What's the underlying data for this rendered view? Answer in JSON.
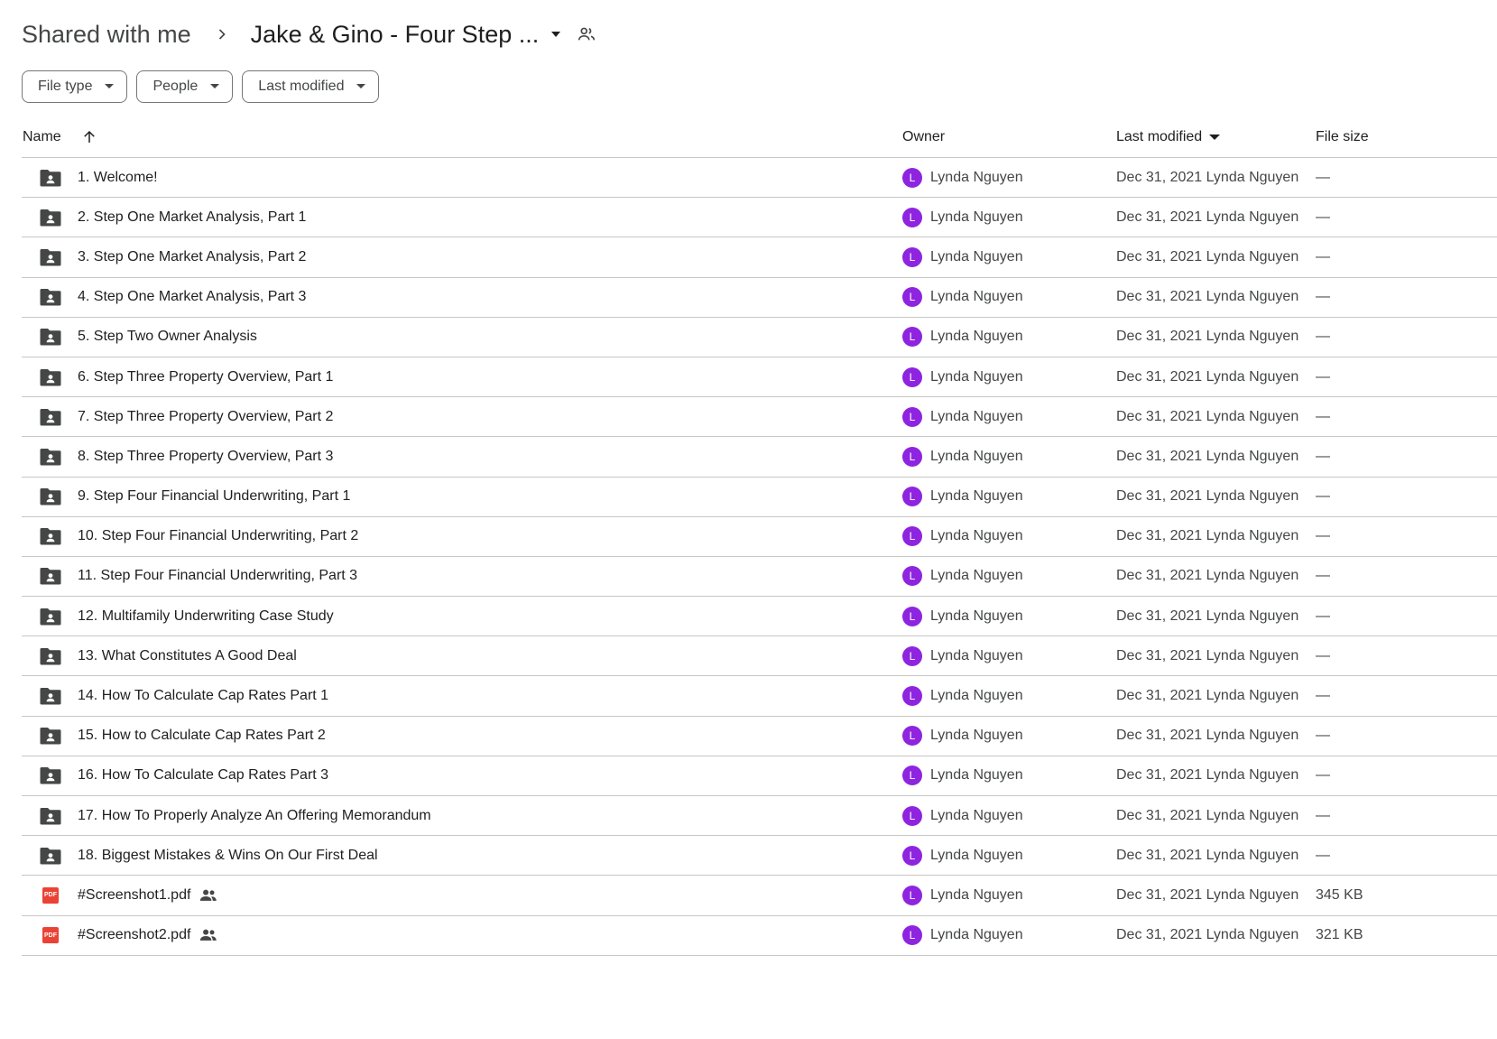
{
  "breadcrumb": {
    "root": "Shared with me",
    "current": "Jake & Gino - Four Step ..."
  },
  "filters": [
    {
      "label": "File type"
    },
    {
      "label": "People"
    },
    {
      "label": "Last modified"
    }
  ],
  "columns": {
    "name": "Name",
    "owner": "Owner",
    "last_modified": "Last modified",
    "file_size": "File size"
  },
  "colors": {
    "avatar": "#8e24e0",
    "folder_icon": "#444746",
    "pdf_icon": "#ea4335"
  },
  "rows": [
    {
      "type": "shared-folder",
      "name": "1. Welcome!",
      "owner_initial": "L",
      "owner": "Lynda Nguyen",
      "modified": "Dec 31, 2021 Lynda Nguyen",
      "size": "—"
    },
    {
      "type": "shared-folder",
      "name": "2. Step One Market Analysis, Part 1",
      "owner_initial": "L",
      "owner": "Lynda Nguyen",
      "modified": "Dec 31, 2021 Lynda Nguyen",
      "size": "—"
    },
    {
      "type": "shared-folder",
      "name": "3. Step One Market Analysis, Part 2",
      "owner_initial": "L",
      "owner": "Lynda Nguyen",
      "modified": "Dec 31, 2021 Lynda Nguyen",
      "size": "—"
    },
    {
      "type": "shared-folder",
      "name": "4. Step One Market Analysis, Part 3",
      "owner_initial": "L",
      "owner": "Lynda Nguyen",
      "modified": "Dec 31, 2021 Lynda Nguyen",
      "size": "—"
    },
    {
      "type": "shared-folder",
      "name": "5. Step Two Owner Analysis",
      "owner_initial": "L",
      "owner": "Lynda Nguyen",
      "modified": "Dec 31, 2021 Lynda Nguyen",
      "size": "—"
    },
    {
      "type": "shared-folder",
      "name": "6. Step Three Property Overview, Part 1",
      "owner_initial": "L",
      "owner": "Lynda Nguyen",
      "modified": "Dec 31, 2021 Lynda Nguyen",
      "size": "—"
    },
    {
      "type": "shared-folder",
      "name": "7. Step Three Property Overview, Part 2",
      "owner_initial": "L",
      "owner": "Lynda Nguyen",
      "modified": "Dec 31, 2021 Lynda Nguyen",
      "size": "—"
    },
    {
      "type": "shared-folder",
      "name": "8. Step Three Property Overview, Part 3",
      "owner_initial": "L",
      "owner": "Lynda Nguyen",
      "modified": "Dec 31, 2021 Lynda Nguyen",
      "size": "—"
    },
    {
      "type": "shared-folder",
      "name": "9. Step Four Financial Underwriting, Part 1",
      "owner_initial": "L",
      "owner": "Lynda Nguyen",
      "modified": "Dec 31, 2021 Lynda Nguyen",
      "size": "—"
    },
    {
      "type": "shared-folder",
      "name": "10. Step Four Financial Underwriting, Part 2",
      "owner_initial": "L",
      "owner": "Lynda Nguyen",
      "modified": "Dec 31, 2021 Lynda Nguyen",
      "size": "—"
    },
    {
      "type": "shared-folder",
      "name": "11. Step Four Financial Underwriting, Part 3",
      "owner_initial": "L",
      "owner": "Lynda Nguyen",
      "modified": "Dec 31, 2021 Lynda Nguyen",
      "size": "—"
    },
    {
      "type": "shared-folder",
      "name": "12. Multifamily Underwriting Case Study",
      "owner_initial": "L",
      "owner": "Lynda Nguyen",
      "modified": "Dec 31, 2021 Lynda Nguyen",
      "size": "—"
    },
    {
      "type": "shared-folder",
      "name": "13. What Constitutes A Good Deal",
      "owner_initial": "L",
      "owner": "Lynda Nguyen",
      "modified": "Dec 31, 2021 Lynda Nguyen",
      "size": "—"
    },
    {
      "type": "shared-folder",
      "name": "14. How To Calculate Cap Rates Part 1",
      "owner_initial": "L",
      "owner": "Lynda Nguyen",
      "modified": "Dec 31, 2021 Lynda Nguyen",
      "size": "—"
    },
    {
      "type": "shared-folder",
      "name": "15. How to Calculate Cap Rates Part 2",
      "owner_initial": "L",
      "owner": "Lynda Nguyen",
      "modified": "Dec 31, 2021 Lynda Nguyen",
      "size": "—"
    },
    {
      "type": "shared-folder",
      "name": "16. How To Calculate Cap Rates Part 3",
      "owner_initial": "L",
      "owner": "Lynda Nguyen",
      "modified": "Dec 31, 2021 Lynda Nguyen",
      "size": "—"
    },
    {
      "type": "shared-folder",
      "name": "17. How To Properly Analyze An Offering Memorandum",
      "owner_initial": "L",
      "owner": "Lynda Nguyen",
      "modified": "Dec 31, 2021 Lynda Nguyen",
      "size": "—"
    },
    {
      "type": "shared-folder",
      "name": "18. Biggest Mistakes & Wins On Our First Deal",
      "owner_initial": "L",
      "owner": "Lynda Nguyen",
      "modified": "Dec 31, 2021 Lynda Nguyen",
      "size": "—"
    },
    {
      "type": "pdf",
      "pdf_label": "PDF",
      "shared": true,
      "name": "#Screenshot1.pdf",
      "owner_initial": "L",
      "owner": "Lynda Nguyen",
      "modified": "Dec 31, 2021 Lynda Nguyen",
      "size": "345 KB"
    },
    {
      "type": "pdf",
      "pdf_label": "PDF",
      "shared": true,
      "name": "#Screenshot2.pdf",
      "owner_initial": "L",
      "owner": "Lynda Nguyen",
      "modified": "Dec 31, 2021 Lynda Nguyen",
      "size": "321 KB"
    }
  ]
}
